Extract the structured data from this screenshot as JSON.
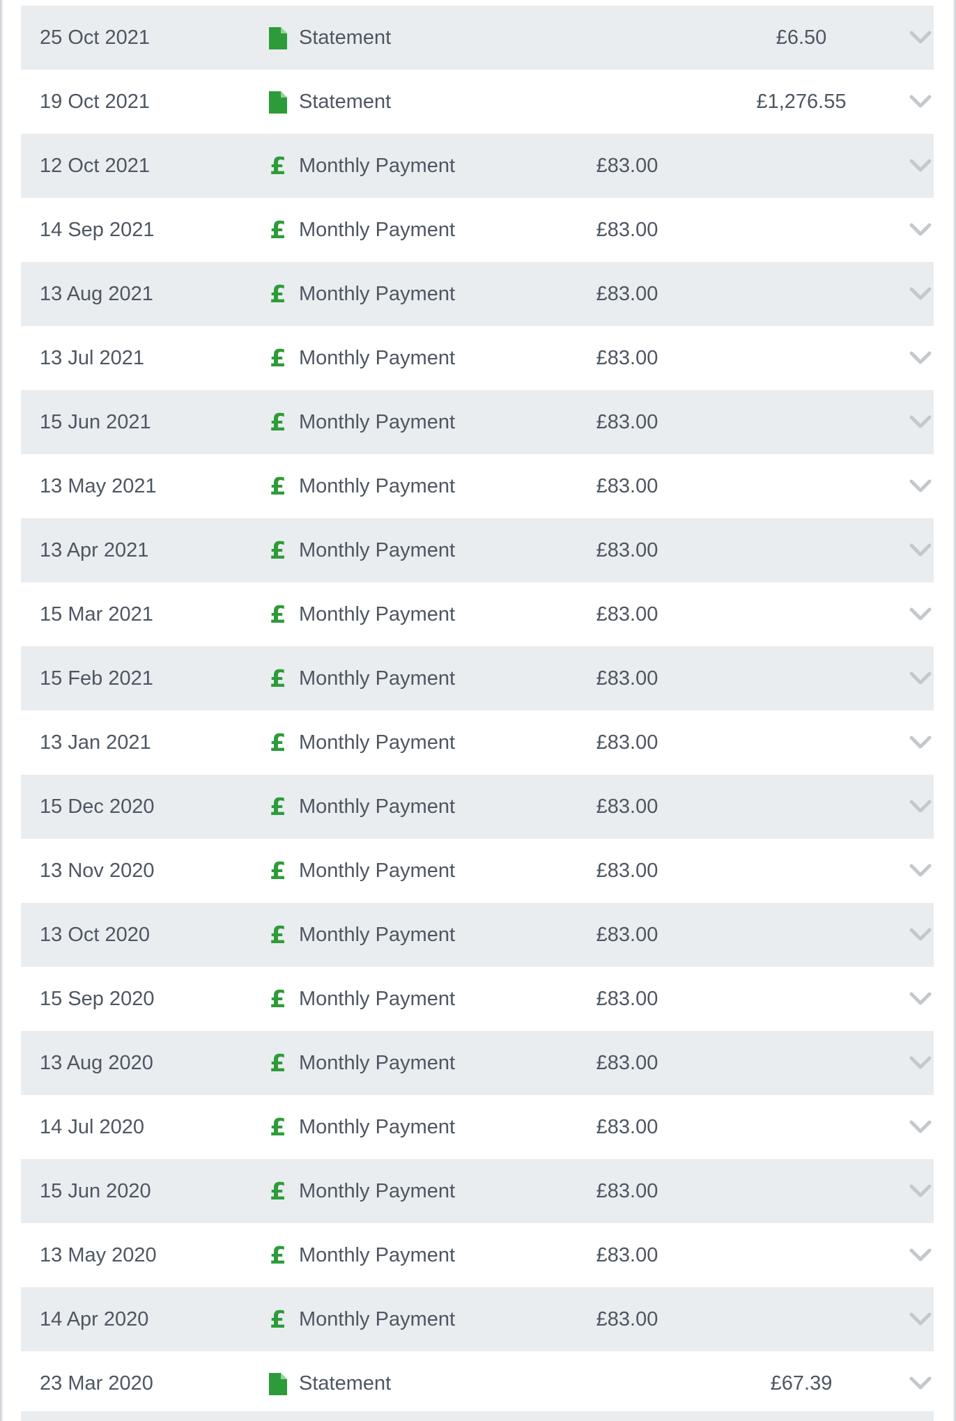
{
  "colors": {
    "row_shade": "#e9edf0",
    "row_plain": "#ffffff",
    "icon_green": "#2e9b3a",
    "text": "#4d5662",
    "chevron": "#c3c8cd"
  },
  "transactions": [
    {
      "date": "25 Oct 2021",
      "type": "statement",
      "icon": "document-icon",
      "description": "Statement",
      "amount_out": "",
      "balance": "£6.50"
    },
    {
      "date": "19 Oct 2021",
      "type": "statement",
      "icon": "document-icon",
      "description": "Statement",
      "amount_out": "",
      "balance": "£1,276.55"
    },
    {
      "date": "12 Oct 2021",
      "type": "payment",
      "icon": "pound-icon",
      "description": "Monthly Payment",
      "amount_out": "£83.00",
      "balance": ""
    },
    {
      "date": "14 Sep 2021",
      "type": "payment",
      "icon": "pound-icon",
      "description": "Monthly Payment",
      "amount_out": "£83.00",
      "balance": ""
    },
    {
      "date": "13 Aug 2021",
      "type": "payment",
      "icon": "pound-icon",
      "description": "Monthly Payment",
      "amount_out": "£83.00",
      "balance": ""
    },
    {
      "date": "13 Jul 2021",
      "type": "payment",
      "icon": "pound-icon",
      "description": "Monthly Payment",
      "amount_out": "£83.00",
      "balance": ""
    },
    {
      "date": "15 Jun 2021",
      "type": "payment",
      "icon": "pound-icon",
      "description": "Monthly Payment",
      "amount_out": "£83.00",
      "balance": ""
    },
    {
      "date": "13 May 2021",
      "type": "payment",
      "icon": "pound-icon",
      "description": "Monthly Payment",
      "amount_out": "£83.00",
      "balance": ""
    },
    {
      "date": "13 Apr 2021",
      "type": "payment",
      "icon": "pound-icon",
      "description": "Monthly Payment",
      "amount_out": "£83.00",
      "balance": ""
    },
    {
      "date": "15 Mar 2021",
      "type": "payment",
      "icon": "pound-icon",
      "description": "Monthly Payment",
      "amount_out": "£83.00",
      "balance": ""
    },
    {
      "date": "15 Feb 2021",
      "type": "payment",
      "icon": "pound-icon",
      "description": "Monthly Payment",
      "amount_out": "£83.00",
      "balance": ""
    },
    {
      "date": "13 Jan 2021",
      "type": "payment",
      "icon": "pound-icon",
      "description": "Monthly Payment",
      "amount_out": "£83.00",
      "balance": ""
    },
    {
      "date": "15 Dec 2020",
      "type": "payment",
      "icon": "pound-icon",
      "description": "Monthly Payment",
      "amount_out": "£83.00",
      "balance": ""
    },
    {
      "date": "13 Nov 2020",
      "type": "payment",
      "icon": "pound-icon",
      "description": "Monthly Payment",
      "amount_out": "£83.00",
      "balance": ""
    },
    {
      "date": "13 Oct 2020",
      "type": "payment",
      "icon": "pound-icon",
      "description": "Monthly Payment",
      "amount_out": "£83.00",
      "balance": ""
    },
    {
      "date": "15 Sep 2020",
      "type": "payment",
      "icon": "pound-icon",
      "description": "Monthly Payment",
      "amount_out": "£83.00",
      "balance": ""
    },
    {
      "date": "13 Aug 2020",
      "type": "payment",
      "icon": "pound-icon",
      "description": "Monthly Payment",
      "amount_out": "£83.00",
      "balance": ""
    },
    {
      "date": "14 Jul 2020",
      "type": "payment",
      "icon": "pound-icon",
      "description": "Monthly Payment",
      "amount_out": "£83.00",
      "balance": ""
    },
    {
      "date": "15 Jun 2020",
      "type": "payment",
      "icon": "pound-icon",
      "description": "Monthly Payment",
      "amount_out": "£83.00",
      "balance": ""
    },
    {
      "date": "13 May 2020",
      "type": "payment",
      "icon": "pound-icon",
      "description": "Monthly Payment",
      "amount_out": "£83.00",
      "balance": ""
    },
    {
      "date": "14 Apr 2020",
      "type": "payment",
      "icon": "pound-icon",
      "description": "Monthly Payment",
      "amount_out": "£83.00",
      "balance": ""
    },
    {
      "date": "23 Mar 2020",
      "type": "statement",
      "icon": "document-icon",
      "description": "Statement",
      "amount_out": "",
      "balance": "£67.39"
    }
  ],
  "pound_glyph": "£"
}
